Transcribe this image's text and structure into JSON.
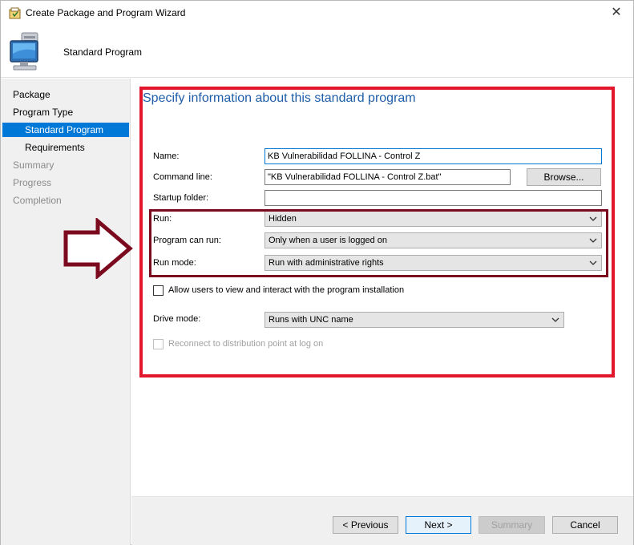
{
  "window": {
    "title": "Create Package and Program Wizard",
    "close_glyph": "✕"
  },
  "banner": {
    "heading": "Standard Program"
  },
  "nav": {
    "items": [
      {
        "label": "Package"
      },
      {
        "label": "Program Type"
      },
      {
        "label": "Standard Program"
      },
      {
        "label": "Requirements"
      },
      {
        "label": "Summary"
      },
      {
        "label": "Progress"
      },
      {
        "label": "Completion"
      }
    ]
  },
  "page": {
    "title": "Specify information about this standard program"
  },
  "form": {
    "name_label": "Name:",
    "name_value": "KB Vulnerabilidad FOLLINA - Control Z",
    "command_label": "Command line:",
    "command_value": "\"KB Vulnerabilidad FOLLINA - Control Z.bat\"",
    "browse_label": "Browse...",
    "startup_label": "Startup folder:",
    "startup_value": "",
    "run_label": "Run:",
    "run_value": "Hidden",
    "can_run_label": "Program can run:",
    "can_run_value": "Only when a user is logged on",
    "run_mode_label": "Run mode:",
    "run_mode_value": "Run with administrative rights",
    "allow_interact_label": "Allow users to view and interact with the program installation",
    "drive_mode_label": "Drive mode:",
    "drive_mode_value": "Runs with UNC name",
    "reconnect_label": "Reconnect to distribution point at log on"
  },
  "buttons": {
    "previous": "< Previous",
    "next": "Next >",
    "summary": "Summary",
    "cancel": "Cancel"
  },
  "colors": {
    "accent": "#0078d7",
    "title_blue": "#1e5ea8",
    "annotation_red": "#e3172b",
    "annotation_maroon": "#7b0a1e"
  }
}
